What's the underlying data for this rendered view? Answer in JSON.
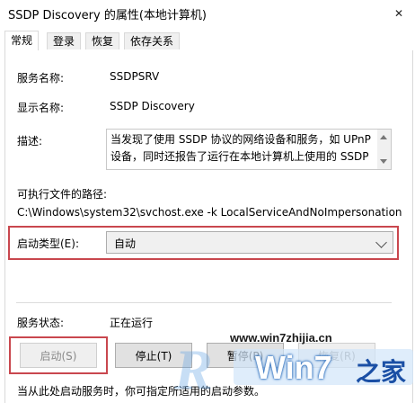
{
  "window": {
    "title": "SSDP Discovery 的属性(本地计算机)",
    "close_glyph": "✕"
  },
  "tabs": [
    {
      "label": "常规",
      "active": true
    },
    {
      "label": "登录",
      "active": false
    },
    {
      "label": "恢复",
      "active": false
    },
    {
      "label": "依存关系",
      "active": false
    }
  ],
  "general": {
    "service_name_label": "服务名称:",
    "service_name_value": "SSDPSRV",
    "display_name_label": "显示名称:",
    "display_name_value": "SSDP Discovery",
    "description_label": "描述:",
    "description_value": "当发现了使用 SSDP 协议的网络设备和服务，如 UPnP 设备，同时还报告了运行在本地计算机上使用的 SSDP",
    "path_label": "可执行文件的路径:",
    "path_value": "C:\\Windows\\system32\\svchost.exe -k LocalServiceAndNoImpersonation",
    "startup_type_label": "启动类型(E):",
    "startup_type_value": "自动",
    "status_label": "服务状态:",
    "status_value": "正在运行",
    "footer_note": "当从此处启动服务时，你可指定所适用的启动参数。"
  },
  "buttons": {
    "start": "启动(S)",
    "stop": "停止(T)",
    "pause": "暂停(P)",
    "resume": "恢复(R)"
  },
  "watermark": {
    "url": "www.win7zhijia.cn",
    "letter": "R",
    "brand": "Win7",
    "brand_suffix": "之家"
  },
  "colors": {
    "highlight": "#c9474e",
    "watermark_blue": "#1a4fa5"
  }
}
